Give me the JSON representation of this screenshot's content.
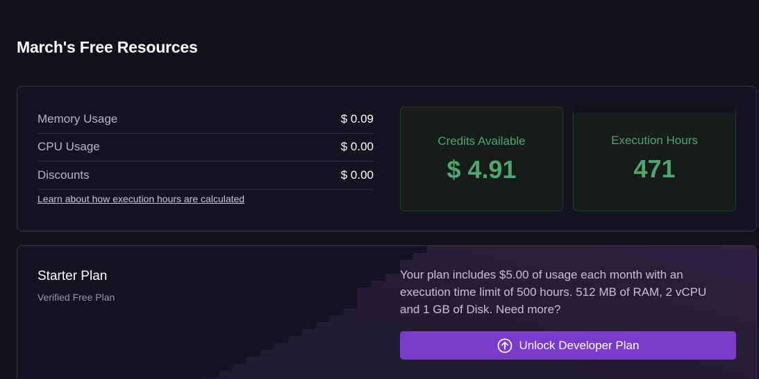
{
  "page": {
    "title": "March's Free Resources"
  },
  "usage": {
    "rows": [
      {
        "label": "Memory Usage",
        "value": "$ 0.09"
      },
      {
        "label": "CPU Usage",
        "value": "$ 0.00"
      },
      {
        "label": "Discounts",
        "value": "$ 0.00"
      }
    ],
    "learn_link": "Learn about how execution hours are calculated"
  },
  "stats": {
    "credits": {
      "label": "Credits Available",
      "value": "$ 4.91"
    },
    "hours": {
      "label": "Execution Hours",
      "value": "471"
    }
  },
  "plan": {
    "name": "Starter Plan",
    "subtitle": "Verified Free Plan",
    "description": "Your plan includes $5.00 of usage each month with an execution time limit of 500 hours. 512 MB of RAM, 2 vCPU and 1 GB of Disk. Need more?",
    "button_label": "Unlock Developer Plan",
    "button_icon": "arrow-up-circle-icon"
  },
  "colors": {
    "background": "#13111c",
    "accent_green": "#4fa470",
    "button_purple": "#7c3aca"
  }
}
